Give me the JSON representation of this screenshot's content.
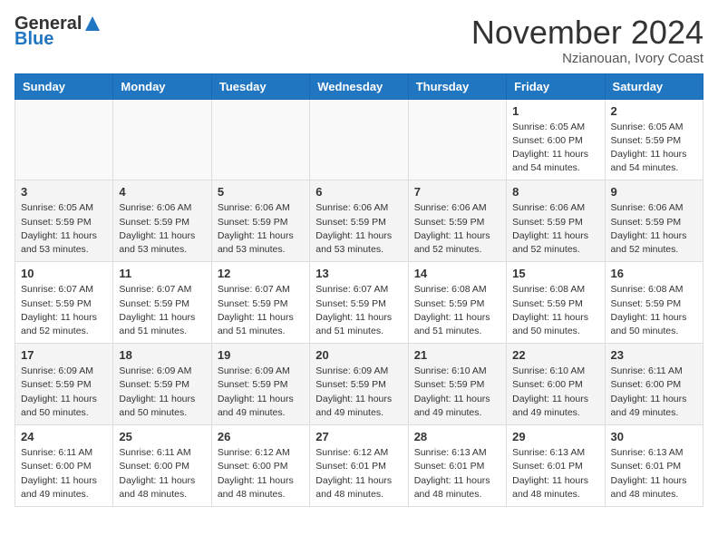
{
  "header": {
    "logo_general": "General",
    "logo_blue": "Blue",
    "month_title": "November 2024",
    "location": "Nzianouan, Ivory Coast"
  },
  "weekdays": [
    "Sunday",
    "Monday",
    "Tuesday",
    "Wednesday",
    "Thursday",
    "Friday",
    "Saturday"
  ],
  "weeks": [
    [
      {
        "day": "",
        "empty": true
      },
      {
        "day": "",
        "empty": true
      },
      {
        "day": "",
        "empty": true
      },
      {
        "day": "",
        "empty": true
      },
      {
        "day": "",
        "empty": true
      },
      {
        "day": "1",
        "sunrise": "Sunrise: 6:05 AM",
        "sunset": "Sunset: 6:00 PM",
        "daylight": "Daylight: 11 hours and 54 minutes."
      },
      {
        "day": "2",
        "sunrise": "Sunrise: 6:05 AM",
        "sunset": "Sunset: 5:59 PM",
        "daylight": "Daylight: 11 hours and 54 minutes."
      }
    ],
    [
      {
        "day": "3",
        "sunrise": "Sunrise: 6:05 AM",
        "sunset": "Sunset: 5:59 PM",
        "daylight": "Daylight: 11 hours and 53 minutes."
      },
      {
        "day": "4",
        "sunrise": "Sunrise: 6:06 AM",
        "sunset": "Sunset: 5:59 PM",
        "daylight": "Daylight: 11 hours and 53 minutes."
      },
      {
        "day": "5",
        "sunrise": "Sunrise: 6:06 AM",
        "sunset": "Sunset: 5:59 PM",
        "daylight": "Daylight: 11 hours and 53 minutes."
      },
      {
        "day": "6",
        "sunrise": "Sunrise: 6:06 AM",
        "sunset": "Sunset: 5:59 PM",
        "daylight": "Daylight: 11 hours and 53 minutes."
      },
      {
        "day": "7",
        "sunrise": "Sunrise: 6:06 AM",
        "sunset": "Sunset: 5:59 PM",
        "daylight": "Daylight: 11 hours and 52 minutes."
      },
      {
        "day": "8",
        "sunrise": "Sunrise: 6:06 AM",
        "sunset": "Sunset: 5:59 PM",
        "daylight": "Daylight: 11 hours and 52 minutes."
      },
      {
        "day": "9",
        "sunrise": "Sunrise: 6:06 AM",
        "sunset": "Sunset: 5:59 PM",
        "daylight": "Daylight: 11 hours and 52 minutes."
      }
    ],
    [
      {
        "day": "10",
        "sunrise": "Sunrise: 6:07 AM",
        "sunset": "Sunset: 5:59 PM",
        "daylight": "Daylight: 11 hours and 52 minutes."
      },
      {
        "day": "11",
        "sunrise": "Sunrise: 6:07 AM",
        "sunset": "Sunset: 5:59 PM",
        "daylight": "Daylight: 11 hours and 51 minutes."
      },
      {
        "day": "12",
        "sunrise": "Sunrise: 6:07 AM",
        "sunset": "Sunset: 5:59 PM",
        "daylight": "Daylight: 11 hours and 51 minutes."
      },
      {
        "day": "13",
        "sunrise": "Sunrise: 6:07 AM",
        "sunset": "Sunset: 5:59 PM",
        "daylight": "Daylight: 11 hours and 51 minutes."
      },
      {
        "day": "14",
        "sunrise": "Sunrise: 6:08 AM",
        "sunset": "Sunset: 5:59 PM",
        "daylight": "Daylight: 11 hours and 51 minutes."
      },
      {
        "day": "15",
        "sunrise": "Sunrise: 6:08 AM",
        "sunset": "Sunset: 5:59 PM",
        "daylight": "Daylight: 11 hours and 50 minutes."
      },
      {
        "day": "16",
        "sunrise": "Sunrise: 6:08 AM",
        "sunset": "Sunset: 5:59 PM",
        "daylight": "Daylight: 11 hours and 50 minutes."
      }
    ],
    [
      {
        "day": "17",
        "sunrise": "Sunrise: 6:09 AM",
        "sunset": "Sunset: 5:59 PM",
        "daylight": "Daylight: 11 hours and 50 minutes."
      },
      {
        "day": "18",
        "sunrise": "Sunrise: 6:09 AM",
        "sunset": "Sunset: 5:59 PM",
        "daylight": "Daylight: 11 hours and 50 minutes."
      },
      {
        "day": "19",
        "sunrise": "Sunrise: 6:09 AM",
        "sunset": "Sunset: 5:59 PM",
        "daylight": "Daylight: 11 hours and 49 minutes."
      },
      {
        "day": "20",
        "sunrise": "Sunrise: 6:09 AM",
        "sunset": "Sunset: 5:59 PM",
        "daylight": "Daylight: 11 hours and 49 minutes."
      },
      {
        "day": "21",
        "sunrise": "Sunrise: 6:10 AM",
        "sunset": "Sunset: 5:59 PM",
        "daylight": "Daylight: 11 hours and 49 minutes."
      },
      {
        "day": "22",
        "sunrise": "Sunrise: 6:10 AM",
        "sunset": "Sunset: 6:00 PM",
        "daylight": "Daylight: 11 hours and 49 minutes."
      },
      {
        "day": "23",
        "sunrise": "Sunrise: 6:11 AM",
        "sunset": "Sunset: 6:00 PM",
        "daylight": "Daylight: 11 hours and 49 minutes."
      }
    ],
    [
      {
        "day": "24",
        "sunrise": "Sunrise: 6:11 AM",
        "sunset": "Sunset: 6:00 PM",
        "daylight": "Daylight: 11 hours and 49 minutes."
      },
      {
        "day": "25",
        "sunrise": "Sunrise: 6:11 AM",
        "sunset": "Sunset: 6:00 PM",
        "daylight": "Daylight: 11 hours and 48 minutes."
      },
      {
        "day": "26",
        "sunrise": "Sunrise: 6:12 AM",
        "sunset": "Sunset: 6:00 PM",
        "daylight": "Daylight: 11 hours and 48 minutes."
      },
      {
        "day": "27",
        "sunrise": "Sunrise: 6:12 AM",
        "sunset": "Sunset: 6:01 PM",
        "daylight": "Daylight: 11 hours and 48 minutes."
      },
      {
        "day": "28",
        "sunrise": "Sunrise: 6:13 AM",
        "sunset": "Sunset: 6:01 PM",
        "daylight": "Daylight: 11 hours and 48 minutes."
      },
      {
        "day": "29",
        "sunrise": "Sunrise: 6:13 AM",
        "sunset": "Sunset: 6:01 PM",
        "daylight": "Daylight: 11 hours and 48 minutes."
      },
      {
        "day": "30",
        "sunrise": "Sunrise: 6:13 AM",
        "sunset": "Sunset: 6:01 PM",
        "daylight": "Daylight: 11 hours and 48 minutes."
      }
    ]
  ]
}
